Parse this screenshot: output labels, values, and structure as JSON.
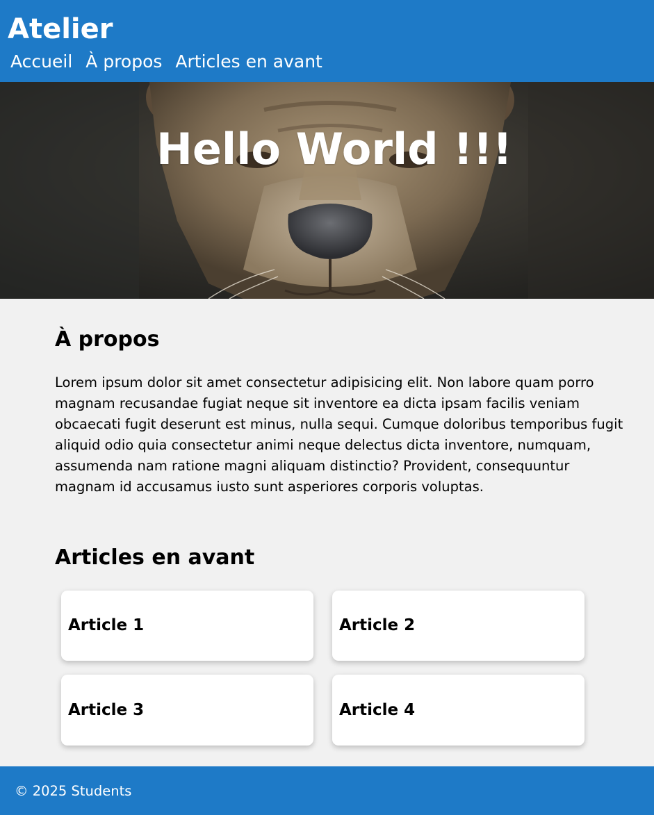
{
  "header": {
    "title": "Atelier",
    "nav": [
      {
        "label": "Accueil"
      },
      {
        "label": "À propos"
      },
      {
        "label": "Articles en avant"
      }
    ]
  },
  "hero": {
    "title": "Hello World !!!",
    "image": "lion-face-photo"
  },
  "about": {
    "title": "À propos",
    "text": "Lorem ipsum dolor sit amet consectetur adipisicing elit. Non labore quam porro magnam recusandae fugiat neque sit inventore ea dicta ipsam facilis veniam obcaecati fugit deserunt est minus, nulla sequi. Cumque doloribus temporibus fugit aliquid odio quia consectetur animi neque delectus dicta inventore, numquam, assumenda nam ratione magni aliquam distinctio? Provident, consequuntur magnam id accusamus iusto sunt asperiores corporis voluptas."
  },
  "featured": {
    "title": "Articles en avant",
    "articles": [
      {
        "title": "Article 1"
      },
      {
        "title": "Article 2"
      },
      {
        "title": "Article 3"
      },
      {
        "title": "Article 4"
      }
    ]
  },
  "footer": {
    "text": "© 2025 Students"
  },
  "colors": {
    "brand": "#1e7ac7",
    "background": "#f1f1f1",
    "card": "#ffffff"
  }
}
